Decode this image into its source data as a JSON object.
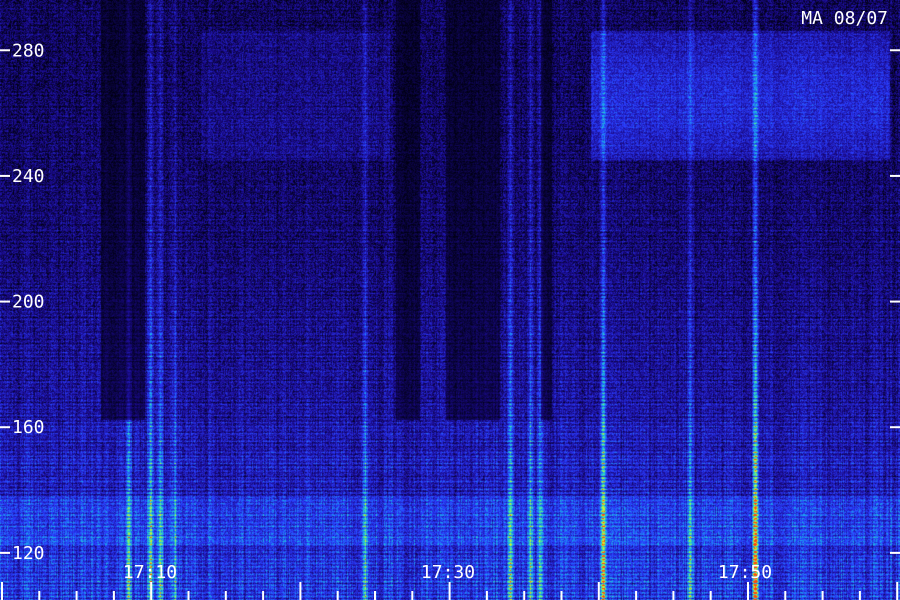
{
  "chart_data": {
    "type": "heatmap",
    "stamp": "MA 08/07",
    "y_ticks": [
      120,
      160,
      200,
      240,
      280
    ],
    "ylim": [
      105,
      296
    ],
    "x_ticks": [
      "17:10",
      "17:30",
      "17:50"
    ],
    "grid": false,
    "colormap": [
      "#000010",
      "#1a0a8a",
      "#2a3cff",
      "#18b8e8",
      "#5af08a",
      "#e8f020",
      "#ff4010"
    ]
  }
}
